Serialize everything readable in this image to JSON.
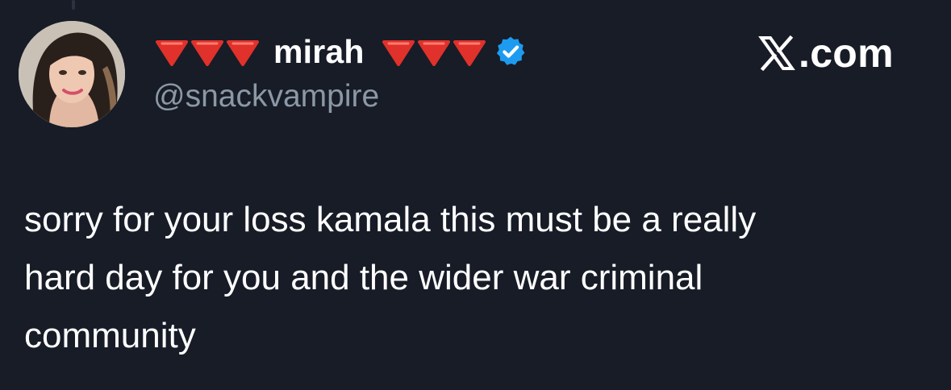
{
  "post": {
    "author": {
      "display_name": "mirah",
      "handle": "@snackvampire",
      "verified": true,
      "name_prefix_emoji": [
        "red-triangle-down",
        "red-triangle-down",
        "red-triangle-down"
      ],
      "name_suffix_emoji": [
        "red-triangle-down",
        "red-triangle-down",
        "red-triangle-down"
      ],
      "avatar": "avatar-photo"
    },
    "brand": {
      "icon": "x-logo-icon",
      "label": ".com"
    },
    "text_lines": [
      "sorry for your loss kamala this must be a really",
      "hard day for you and the wider war criminal",
      "community"
    ]
  },
  "colors": {
    "background": "#171c27",
    "primary_text": "#ffffff",
    "secondary_text": "#8b98a5",
    "verified_blue": "#1d9bf0",
    "emoji_red": "#e0312a"
  }
}
